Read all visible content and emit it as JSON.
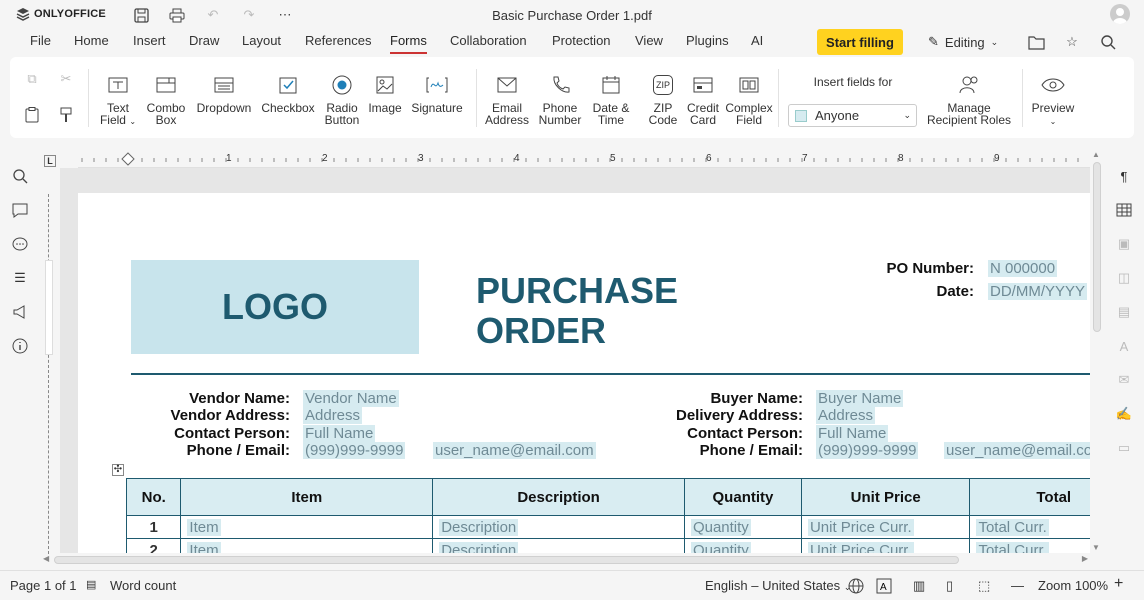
{
  "app": {
    "brand": "ONLYOFFICE",
    "doc_title": "Basic Purchase Order 1.pdf"
  },
  "menu": {
    "items": [
      "File",
      "Home",
      "Insert",
      "Draw",
      "Layout",
      "References",
      "Forms",
      "Collaboration",
      "Protection",
      "View",
      "Plugins",
      "AI"
    ],
    "active": "Forms",
    "start_filling": "Start filling",
    "editing": "Editing"
  },
  "ribbon": {
    "text_field": "Text Field",
    "combo_box": "Combo Box",
    "dropdown": "Dropdown",
    "checkbox": "Checkbox",
    "radio_button": "Radio Button",
    "image": "Image",
    "signature": "Signature",
    "email_address": "Email Address",
    "phone_number": "Phone Number",
    "date_time": "Date & Time",
    "zip_code": "ZIP Code",
    "credit_card": "Credit Card",
    "complex_field": "Complex Field",
    "insert_fields_for": "Insert fields for",
    "recipient": "Anyone",
    "manage_roles": "Manage Recipient Roles",
    "preview": "Preview",
    "zip_icon_text": "ZIP"
  },
  "document": {
    "logo": "LOGO",
    "title_line1": "PURCHASE",
    "title_line2": "ORDER",
    "po_number_label": "PO Number:",
    "po_number_value": "N 000000",
    "date_label": "Date:",
    "date_value": "DD/MM/YYYY",
    "vendor": {
      "name_label": "Vendor Name:",
      "name": "Vendor Name",
      "address_label": "Vendor Address:",
      "address": "Address",
      "contact_label": "Contact Person:",
      "contact": "Full Name",
      "phone_label": "Phone / Email:",
      "phone": "(999)999-9999",
      "email": "user_name@email.com"
    },
    "buyer": {
      "name_label": "Buyer Name:",
      "name": "Buyer Name",
      "address_label": "Delivery Address:",
      "address": "Address",
      "contact_label": "Contact Person:",
      "contact": "Full Name",
      "phone_label": "Phone / Email:",
      "phone": "(999)999-9999",
      "email": "user_name@email.co"
    },
    "table": {
      "headers": [
        "No.",
        "Item",
        "Description",
        "Quantity",
        "Unit Price",
        "Total"
      ],
      "rows": [
        [
          "1",
          "Item",
          "Description",
          "Quantity",
          "Unit Price Curr.",
          "Total Curr."
        ],
        [
          "2",
          "Item",
          "Description",
          "Quantity",
          "Unit Price Curr.",
          "Total Curr."
        ]
      ]
    }
  },
  "ruler": {
    "numbers": [
      "1",
      "2",
      "3",
      "4",
      "5",
      "6",
      "7",
      "8",
      "9"
    ]
  },
  "status": {
    "page": "Page 1 of 1",
    "word_count": "Word count",
    "language": "English – United States",
    "zoom": "Zoom 100%"
  }
}
